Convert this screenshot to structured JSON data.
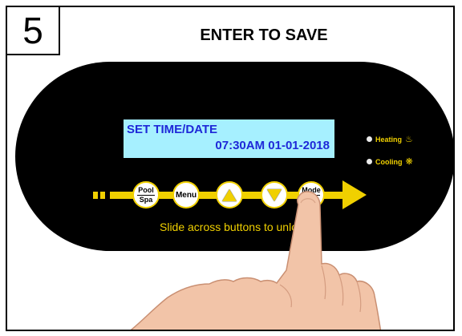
{
  "step": {
    "number": "5"
  },
  "title": "ENTER TO SAVE",
  "display": {
    "line1": "SET TIME/DATE",
    "line2": "07:30AM 01-01-2018"
  },
  "indicators": {
    "heating": {
      "label": "Heating",
      "icon": "flame-icon"
    },
    "cooling": {
      "label": "Cooling",
      "icon": "snowflake-icon"
    }
  },
  "buttons": {
    "pool": "Pool",
    "spa": "Spa",
    "menu": "Menu",
    "mode": "Mode"
  },
  "slide_text": "Slide across buttons to unlock",
  "colors": {
    "panel": "#000000",
    "accent": "#f0d000",
    "lcd_background": "#a6f0ff",
    "lcd_text": "#1e28d8"
  }
}
